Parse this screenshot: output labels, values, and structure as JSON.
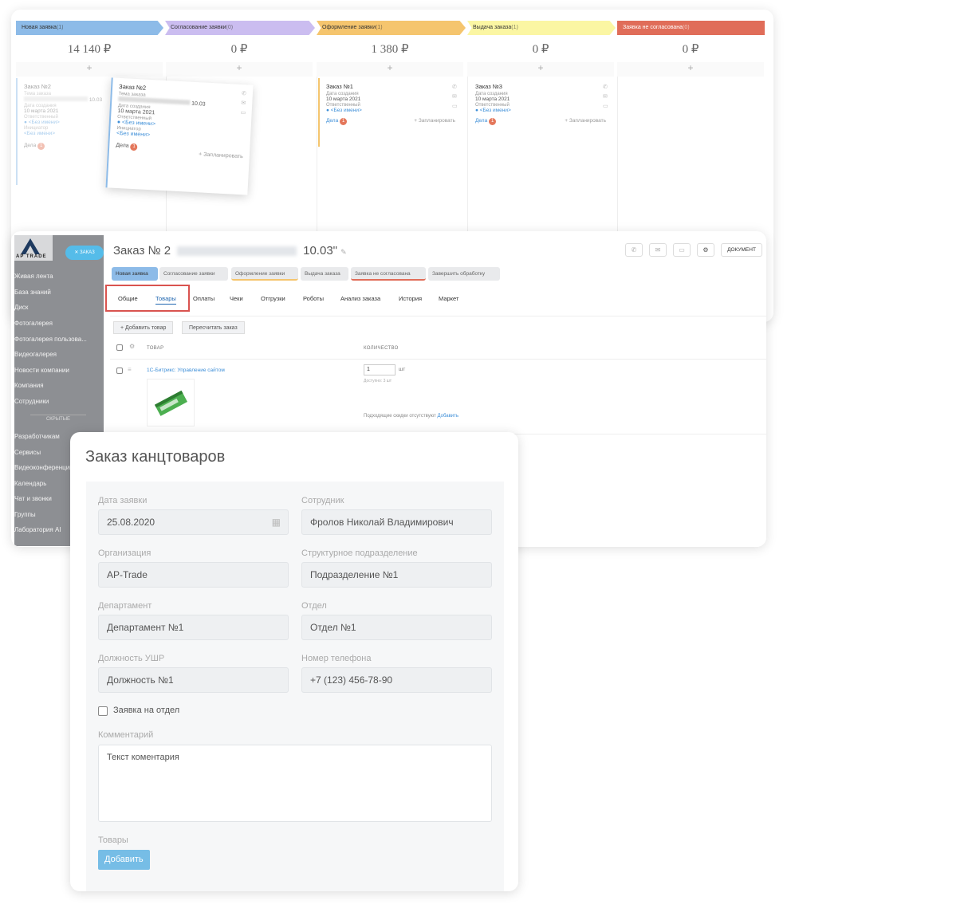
{
  "kanban": {
    "stages": [
      {
        "name": "Новая заявка",
        "count": "(1)",
        "color": "#8dbbe8"
      },
      {
        "name": "Согласование заявки",
        "count": "(0)",
        "color": "#cbbdf0"
      },
      {
        "name": "Оформление заявки",
        "count": "(1)",
        "color": "#f5c56e"
      },
      {
        "name": "Выдача заказа",
        "count": "(1)",
        "color": "#fbf6a3"
      },
      {
        "name": "Заявка не согласована",
        "count": "(0)",
        "color": "#e06d59"
      }
    ],
    "sums": [
      "14 140 ₽",
      "0 ₽",
      "1 380 ₽",
      "0 ₽",
      "0 ₽"
    ],
    "plus": "+",
    "cards": {
      "ghost": {
        "title": "Заказ №2",
        "topic": "Тема заказа",
        "date_suffix": "10.03",
        "created_label": "Дата создания",
        "created": "10 марта 2021",
        "resp_label": "Ответственный",
        "resp": "<Без имени>",
        "init_label": "Инициатор",
        "init": "<Без имени>",
        "deals": "Дела",
        "deals_count": "1"
      },
      "dragged": {
        "title": "Заказ №2",
        "topic": "Тема заказа",
        "date_suffix": "10.03",
        "created_label": "Дата создания",
        "created": "10 марта 2021",
        "resp_label": "Ответственный",
        "resp": "<Без имени>",
        "init_label": "Инициатор",
        "init": "<Без имени>",
        "deals": "Дела",
        "deals_count": "1",
        "plan": "+ Запланировать"
      },
      "c1": {
        "title": "Заказ №1",
        "created_label": "Дата создания",
        "created": "10 марта 2021",
        "resp_label": "Ответственный",
        "resp": "<Без имени>",
        "deals": "Дела",
        "deals_count": "1",
        "plan": "+ Запланировать"
      },
      "c3": {
        "title": "Заказ №3",
        "created_label": "Дата создания",
        "created": "10 марта 2021",
        "resp_label": "Ответственный",
        "resp": "<Без имени>",
        "deals": "Дела",
        "deals_count": "1",
        "plan": "+ Запланировать"
      }
    }
  },
  "crm": {
    "logo_text": "AP TRADE",
    "order_badge": "✕ ЗАКАЗ",
    "menu": [
      "Живая лента",
      "База знаний",
      "Диск",
      "Фотогалерея",
      "Фотогалерея пользова...",
      "Видеогалерея",
      "Новости компании",
      "Компания",
      "Сотрудники"
    ],
    "menu_sep": "СКРЫТЫЕ",
    "menu2": [
      "Разработчикам",
      "Сервисы",
      "Видеоконференции",
      "Календарь",
      "Чат и звонки",
      "Группы",
      "Лаборатория AI"
    ],
    "title_prefix": "Заказ № 2",
    "title_suffix": "10.03\"",
    "stages": [
      "Новая заявка",
      "Согласование заявки",
      "Оформление заявки",
      "Выдача заказа",
      "Заявка не согласована",
      "Завершить обработку"
    ],
    "tabs": [
      "Общие",
      "Товары",
      "Оплаты",
      "Чеки",
      "Отгрузки",
      "Роботы",
      "Анализ заказа",
      "История",
      "Маркет"
    ],
    "buttons": {
      "add_product": "+ Добавить товар",
      "recalc": "Пересчитать заказ",
      "document": "ДОКУМЕНТ"
    },
    "table": {
      "col_product": "ТОВАР",
      "col_qty": "КОЛИЧЕСТВО",
      "product": "1С-Битрикс: Управление сайтом",
      "qty": "1",
      "unit": "шт",
      "available": "Доступно: 3 шт",
      "discount_note": "Подходящие скидки отсутствуют",
      "discount_link": "Добавить"
    }
  },
  "form": {
    "title": "Заказ канцтоваров",
    "fields": {
      "date_label": "Дата заявки",
      "date": "25.08.2020",
      "employee_label": "Сотрудник",
      "employee": "Фролов Николай Владимирович",
      "org_label": "Организация",
      "org": "AP-Trade",
      "unit_label": "Структурное подразделение",
      "unit": "Подразделение №1",
      "dept_label": "Департамент",
      "dept": "Департамент №1",
      "section_label": "Отдел",
      "section": "Отдел №1",
      "pos_label": "Должность УШР",
      "pos": "Должность №1",
      "phone_label": "Номер телефона",
      "phone": "+7 (123) 456-78-90",
      "checkbox_label": "Заявка на отдел",
      "comment_label": "Комментарий",
      "comment": "Текст коментария",
      "products_label": "Товары",
      "add_button": "Добавить"
    }
  }
}
